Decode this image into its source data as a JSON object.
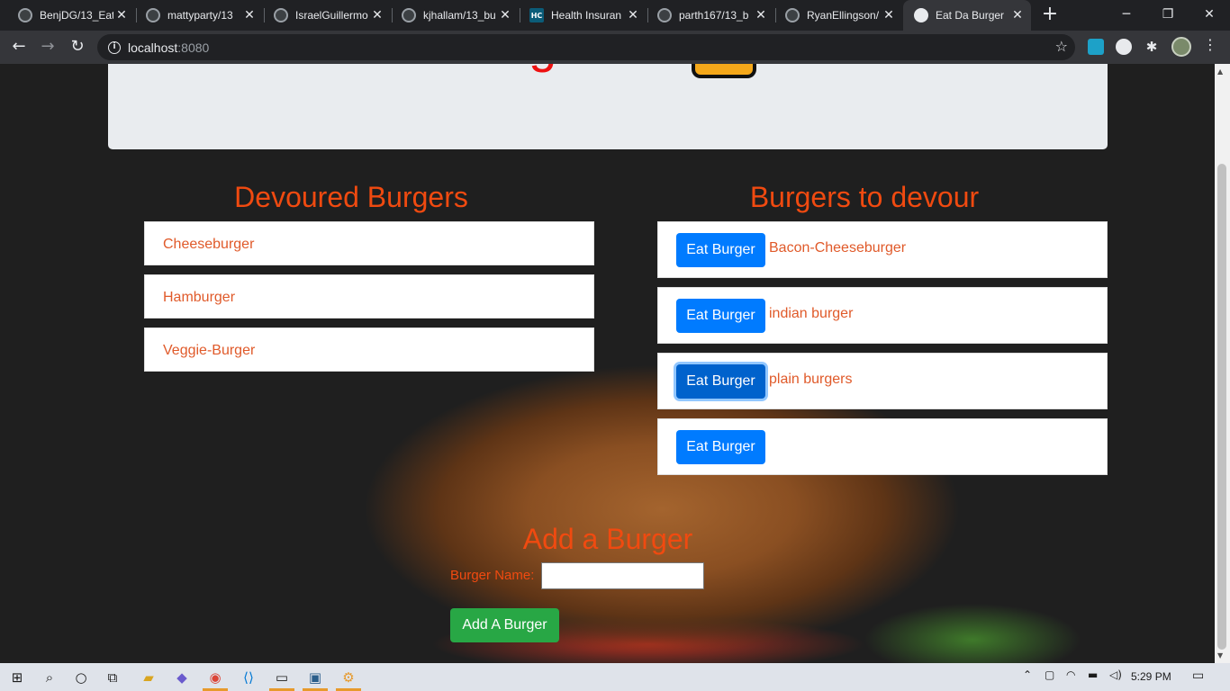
{
  "browser": {
    "tabs": [
      {
        "title": "BenjDG/13_Eat",
        "favicon": "github-icon"
      },
      {
        "title": "mattyparty/13",
        "favicon": "github-icon"
      },
      {
        "title": "IsraelGuillermo",
        "favicon": "github-icon"
      },
      {
        "title": "kjhallam/13_bu",
        "favicon": "github-icon"
      },
      {
        "title": "Health Insuran",
        "favicon": "hc-icon",
        "favicon_text": "HC"
      },
      {
        "title": "parth167/13_b",
        "favicon": "github-icon"
      },
      {
        "title": "RyanEllingson/",
        "favicon": "github-icon"
      },
      {
        "title": "Eat Da Burger",
        "favicon": "globe-icon",
        "active": true
      }
    ],
    "new_tab": "+",
    "url_host": "localhost",
    "url_port": ":8080"
  },
  "page": {
    "jumbotron_title": "Burgers!",
    "devoured": {
      "heading": "Devoured Burgers",
      "items": [
        "Cheeseburger",
        "Hamburger",
        "Veggie-Burger"
      ]
    },
    "to_devour": {
      "heading": "Burgers to devour",
      "button_label": "Eat Burger",
      "items": [
        "Bacon-Cheeseburger",
        "indian burger",
        "plain burgers",
        ""
      ]
    },
    "add_form": {
      "heading": "Add a Burger",
      "label": "Burger Name:",
      "input_value": "",
      "submit_label": "Add A Burger"
    }
  },
  "taskbar": {
    "time": "5:29 PM"
  },
  "colors": {
    "accent_orange": "#f04a10",
    "item_text": "#e05a2a",
    "eat_button": "#007bff",
    "add_button": "#28a745",
    "title_red": "#ee1111"
  }
}
